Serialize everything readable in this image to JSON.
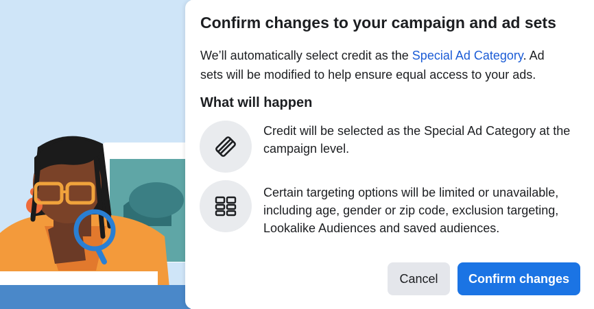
{
  "dialog": {
    "title": "Confirm changes to your campaign and ad sets",
    "intro_before_link": "We’ll automatically select credit as the ",
    "intro_link": "Special Ad Category",
    "intro_after_link": ". Ad sets will be modified to help ensure equal access to your ads.",
    "section_heading": "What will happen",
    "items": [
      {
        "icon": "credit-card-icon",
        "text": "Credit will be selected as the Special Ad Category at the campaign level."
      },
      {
        "icon": "grid-layout-icon",
        "text": "Certain targeting options will be limited or unavailable, including age, gender or zip code, exclusion targeting, Lookalike Audiences and saved audiences."
      }
    ],
    "cancel_label": "Cancel",
    "confirm_label": "Confirm changes"
  },
  "colors": {
    "accent": "#1b74e4",
    "link": "#1b5cd6",
    "illustration_background": "#cfe5f8"
  }
}
